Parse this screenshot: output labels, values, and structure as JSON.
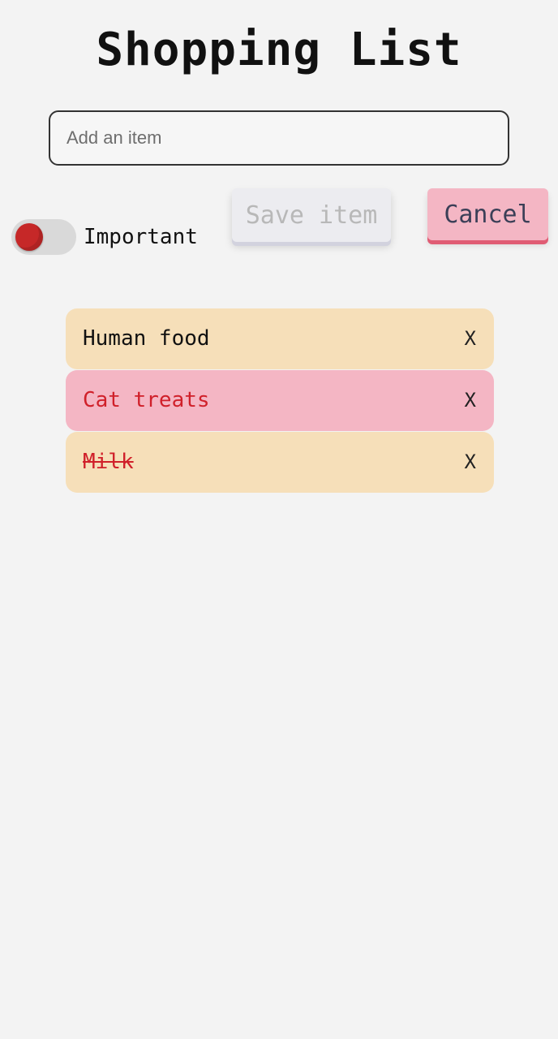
{
  "header": {
    "title": "Shopping List"
  },
  "input": {
    "placeholder": "Add an item",
    "value": ""
  },
  "toggle": {
    "label": "Important",
    "checked": true,
    "knob_color": "#c62828"
  },
  "buttons": {
    "save_label": "Save item",
    "cancel_label": "Cancel"
  },
  "items": [
    {
      "text": "Human food",
      "remove_label": "X",
      "important": false,
      "done": false
    },
    {
      "text": "Cat treats",
      "remove_label": "X",
      "important": true,
      "done": false
    },
    {
      "text": "Milk",
      "remove_label": "X",
      "important": false,
      "done": true
    }
  ],
  "colors": {
    "background": "#f3f3f3",
    "item_normal": "#f6dfb9",
    "item_important": "#f4b6c4",
    "important_text": "#d0202a",
    "cancel_bg": "#f4b6c4",
    "cancel_shadow": "#e05c74"
  }
}
